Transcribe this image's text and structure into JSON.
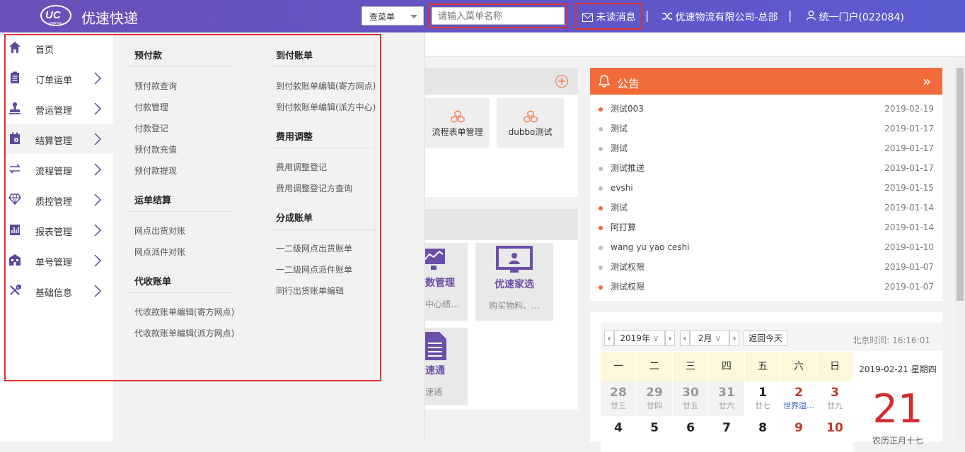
{
  "header": {
    "brand": "优速快递",
    "menu_select": "查菜单",
    "search_placeholder": "请输入菜单名称",
    "unread": "未读消息",
    "sep": "|",
    "company": "优速物流有限公司-总部",
    "portal": "统一门户(022084)"
  },
  "sidebar": [
    {
      "label": "首页",
      "icon": "home-icon"
    },
    {
      "label": "订单运单",
      "icon": "clipboard-icon"
    },
    {
      "label": "营运管理",
      "icon": "stamp-icon"
    },
    {
      "label": "结算管理",
      "icon": "settlement-icon"
    },
    {
      "label": "流程管理",
      "icon": "exchange-icon"
    },
    {
      "label": "质控管理",
      "icon": "diamond-icon"
    },
    {
      "label": "报表管理",
      "icon": "report-icon"
    },
    {
      "label": "单号管理",
      "icon": "building-icon"
    },
    {
      "label": "基础信息",
      "icon": "tools-icon"
    }
  ],
  "flyout": {
    "col1": [
      {
        "title": "预付款",
        "links": [
          "预付款查询",
          "付款管理",
          "付款登记",
          "预付款充值",
          "预付款提现"
        ]
      },
      {
        "title": "运单结算",
        "links": [
          "网点出货对账",
          "网点派件对账"
        ]
      },
      {
        "title": "代收账单",
        "links": [
          "代收款账单编辑(寄方网点)",
          "代收款账单编辑(派方网点)"
        ]
      }
    ],
    "col2": [
      {
        "title": "到付账单",
        "links": [
          "到付款账单编辑(寄方网点)",
          "到付款账单编辑(派方中心)"
        ]
      },
      {
        "title": "费用调整",
        "links": [
          "费用调整登记",
          "费用调整登记方查询"
        ]
      },
      {
        "title": "分成账单",
        "links": [
          "一二级网点出货账单",
          "一二级网点派件账单",
          "同行出货账单编辑"
        ]
      }
    ]
  },
  "tiles": {
    "t1": "流程表单管理",
    "t2": "dubbo测试",
    "big1_title": "数管理",
    "big1_sub": "中心绩…",
    "big2_title": "优速家选",
    "big2_sub": "购买物料、…",
    "big3_title": "速通",
    "big3_sub": "速通"
  },
  "notice": {
    "title": "公告",
    "items": [
      {
        "text": "测试003",
        "date": "2019-02-19",
        "color": "#f26b3a"
      },
      {
        "text": "测试",
        "date": "2019-01-17",
        "color": "#bbbbbb"
      },
      {
        "text": "测试",
        "date": "2019-01-17",
        "color": "#bbbbbb"
      },
      {
        "text": "测试推送",
        "date": "2019-01-17",
        "color": "#bbbbbb"
      },
      {
        "text": "evshi",
        "date": "2019-01-15",
        "color": "#bbbbbb"
      },
      {
        "text": "测试",
        "date": "2019-01-14",
        "color": "#f26b3a"
      },
      {
        "text": "阿打算",
        "date": "2019-01-14",
        "color": "#f26b3a"
      },
      {
        "text": "wang yu yao ceshi",
        "date": "2019-01-10",
        "color": "#bbbbbb"
      },
      {
        "text": "测试权限",
        "date": "2019-01-07",
        "color": "#bbbbbb"
      },
      {
        "text": "测试权限",
        "date": "2019-01-07",
        "color": "#f26b3a"
      }
    ]
  },
  "calendar": {
    "year": "2019年",
    "month": "2月",
    "today_btn": "返回今天",
    "bj_time": "北京时间: 16:16:01",
    "weekdays": [
      "一",
      "二",
      "三",
      "四",
      "五",
      "六",
      "日"
    ],
    "row1": [
      {
        "n": "28",
        "l": "廿三",
        "c": "#999"
      },
      {
        "n": "29",
        "l": "廿四",
        "c": "#999"
      },
      {
        "n": "30",
        "l": "廿五",
        "c": "#999"
      },
      {
        "n": "31",
        "l": "廿六",
        "c": "#999"
      },
      {
        "n": "1",
        "l": "廿七",
        "c": "#222"
      },
      {
        "n": "2",
        "l": "世界湿…",
        "c": "#c0392b"
      },
      {
        "n": "3",
        "l": "廿九",
        "c": "#c0392b"
      }
    ],
    "row2": [
      {
        "n": "4",
        "c": "#222"
      },
      {
        "n": "5",
        "c": "#222"
      },
      {
        "n": "6",
        "c": "#222"
      },
      {
        "n": "7",
        "c": "#222"
      },
      {
        "n": "8",
        "c": "#222"
      },
      {
        "n": "9",
        "c": "#c0392b"
      },
      {
        "n": "10",
        "c": "#c0392b"
      }
    ],
    "side_date": "2019-02-21  星期四",
    "side_day": "21",
    "side_lunar": "农历正月十七"
  }
}
